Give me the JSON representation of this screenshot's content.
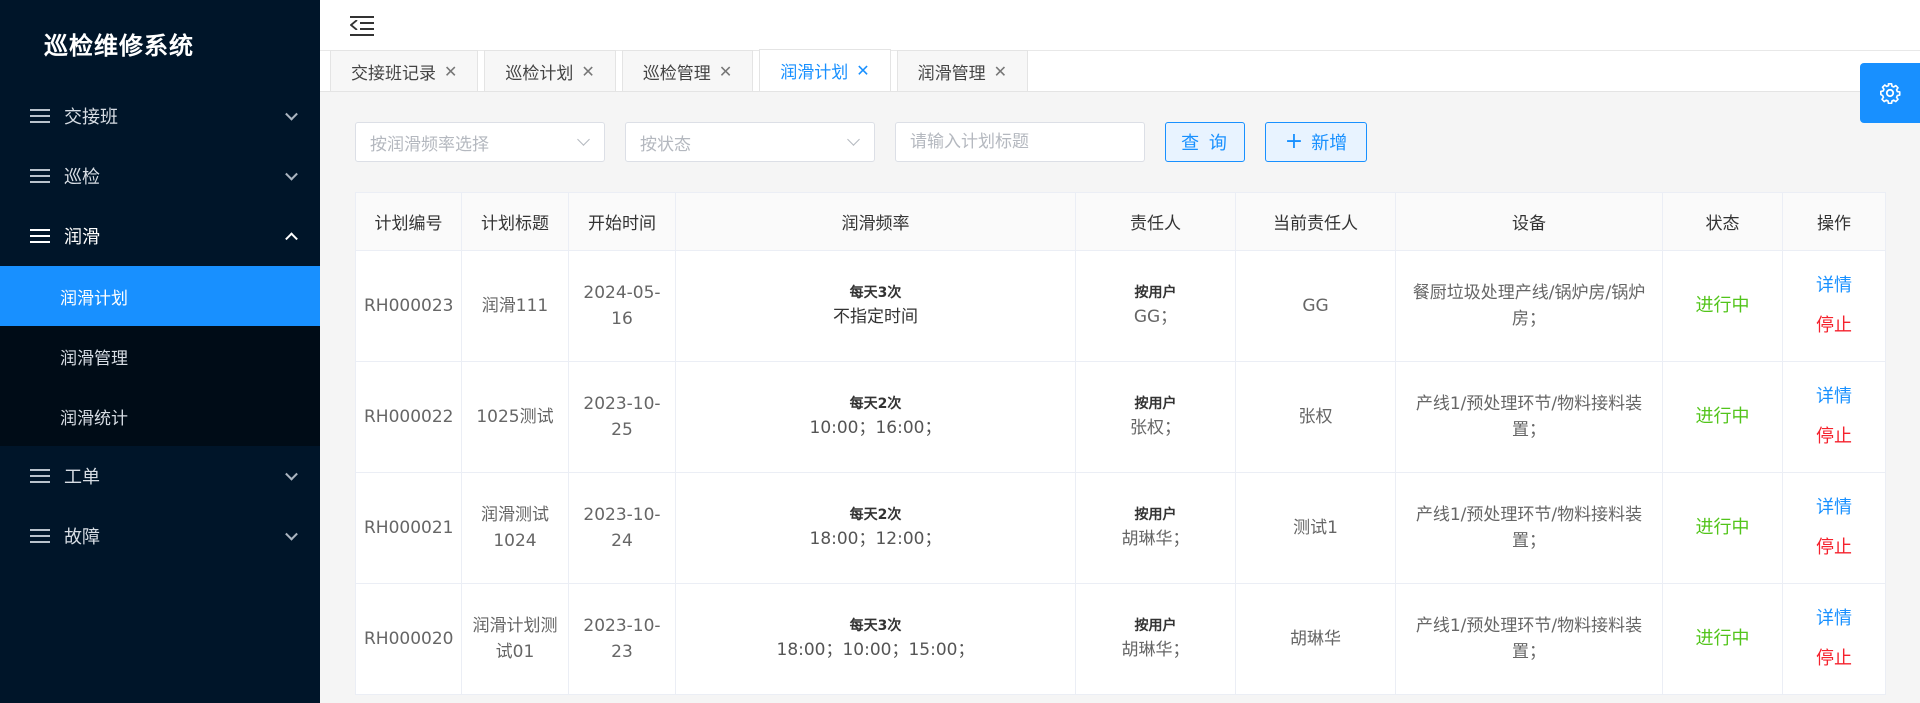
{
  "app": {
    "title": "巡检维修系统"
  },
  "sidebar": {
    "menus": [
      {
        "label": "交接班",
        "open": false
      },
      {
        "label": "巡检",
        "open": false
      },
      {
        "label": "润滑",
        "open": true,
        "children": [
          {
            "label": "润滑计划",
            "active": true
          },
          {
            "label": "润滑管理",
            "active": false
          },
          {
            "label": "润滑统计",
            "active": false
          }
        ]
      },
      {
        "label": "工单",
        "open": false
      },
      {
        "label": "故障",
        "open": false
      }
    ]
  },
  "tabs": [
    {
      "label": "交接班记录",
      "active": false
    },
    {
      "label": "巡检计划",
      "active": false
    },
    {
      "label": "巡检管理",
      "active": false
    },
    {
      "label": "润滑计划",
      "active": true
    },
    {
      "label": "润滑管理",
      "active": false
    }
  ],
  "toolbar": {
    "frequency_placeholder": "按润滑频率选择",
    "status_placeholder": "按状态",
    "title_placeholder": "请输入计划标题",
    "query_label": "查 询",
    "add_label": "新增"
  },
  "table": {
    "columns": [
      "计划编号",
      "计划标题",
      "开始时间",
      "润滑频率",
      "责任人",
      "当前责任人",
      "设备",
      "状态",
      "操作"
    ],
    "rows": [
      {
        "id": "RH000023",
        "title": "润滑111",
        "start": "2024-05-16",
        "freq_title": "每天3次",
        "freq_times": "不指定时间",
        "resp_type": "按用户",
        "resp": "GG；",
        "current": "GG",
        "device": "餐厨垃圾处理产线/锅炉房/锅炉房；",
        "status": "进行中",
        "op_detail": "详情",
        "op_stop": "停止"
      },
      {
        "id": "RH000022",
        "title": "1025测试",
        "start": "2023-10-25",
        "freq_title": "每天2次",
        "freq_times": "10:00；16:00；",
        "resp_type": "按用户",
        "resp": "张权；",
        "current": "张权",
        "device": "产线1/预处理环节/物料接料装置；",
        "status": "进行中",
        "op_detail": "详情",
        "op_stop": "停止"
      },
      {
        "id": "RH000021",
        "title": "润滑测试1024",
        "start": "2023-10-24",
        "freq_title": "每天2次",
        "freq_times": "18:00；12:00；",
        "resp_type": "按用户",
        "resp": "胡琳华；",
        "current": "测试1",
        "device": "产线1/预处理环节/物料接料装置；",
        "status": "进行中",
        "op_detail": "详情",
        "op_stop": "停止"
      },
      {
        "id": "RH000020",
        "title": "润滑计划测试01",
        "start": "2023-10-23",
        "freq_title": "每天3次",
        "freq_times": "18:00；10:00；15:00；",
        "resp_type": "按用户",
        "resp": "胡琳华；",
        "current": "胡琳华",
        "device": "产线1/预处理环节/物料接料装置；",
        "status": "进行中",
        "op_detail": "详情",
        "op_stop": "停止"
      }
    ]
  },
  "colors": {
    "primary": "#1890ff",
    "sidebar_bg": "#001529",
    "success": "#52c41a",
    "danger": "#f5222d"
  }
}
